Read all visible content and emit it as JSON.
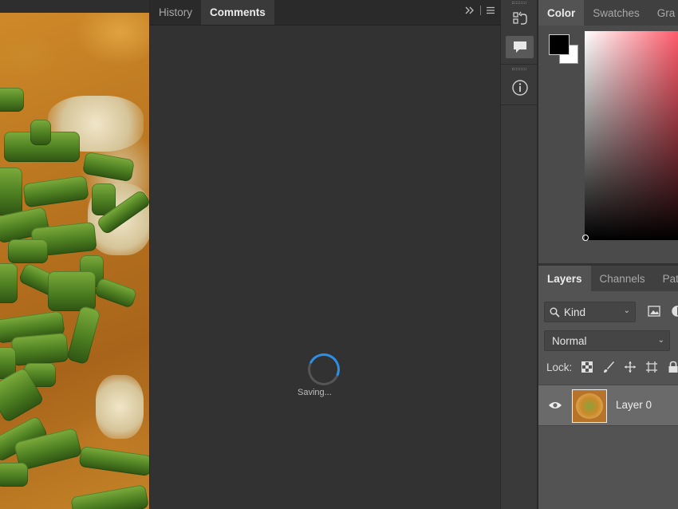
{
  "comments_panel": {
    "tabs": [
      {
        "label": "History",
        "active": false
      },
      {
        "label": "Comments",
        "active": true
      }
    ],
    "status_text": "Saving..."
  },
  "color_panel": {
    "tabs": [
      {
        "label": "Color",
        "active": true
      },
      {
        "label": "Swatches",
        "active": false
      },
      {
        "label": "Gra",
        "active": false
      }
    ],
    "foreground_color": "#000000",
    "background_color": "#ffffff",
    "picker_hue": "#ff5b6b"
  },
  "layers_panel": {
    "tabs": [
      {
        "label": "Layers",
        "active": true
      },
      {
        "label": "Channels",
        "active": false
      },
      {
        "label": "Pat",
        "active": false
      }
    ],
    "filter_label": "Kind",
    "blend_mode": "Normal",
    "lock_label": "Lock:",
    "layers": [
      {
        "name": "Layer 0",
        "visible": true
      }
    ]
  },
  "colors": {
    "accent_spinner": "#2e8fe6",
    "panel_bg": "#323232"
  }
}
